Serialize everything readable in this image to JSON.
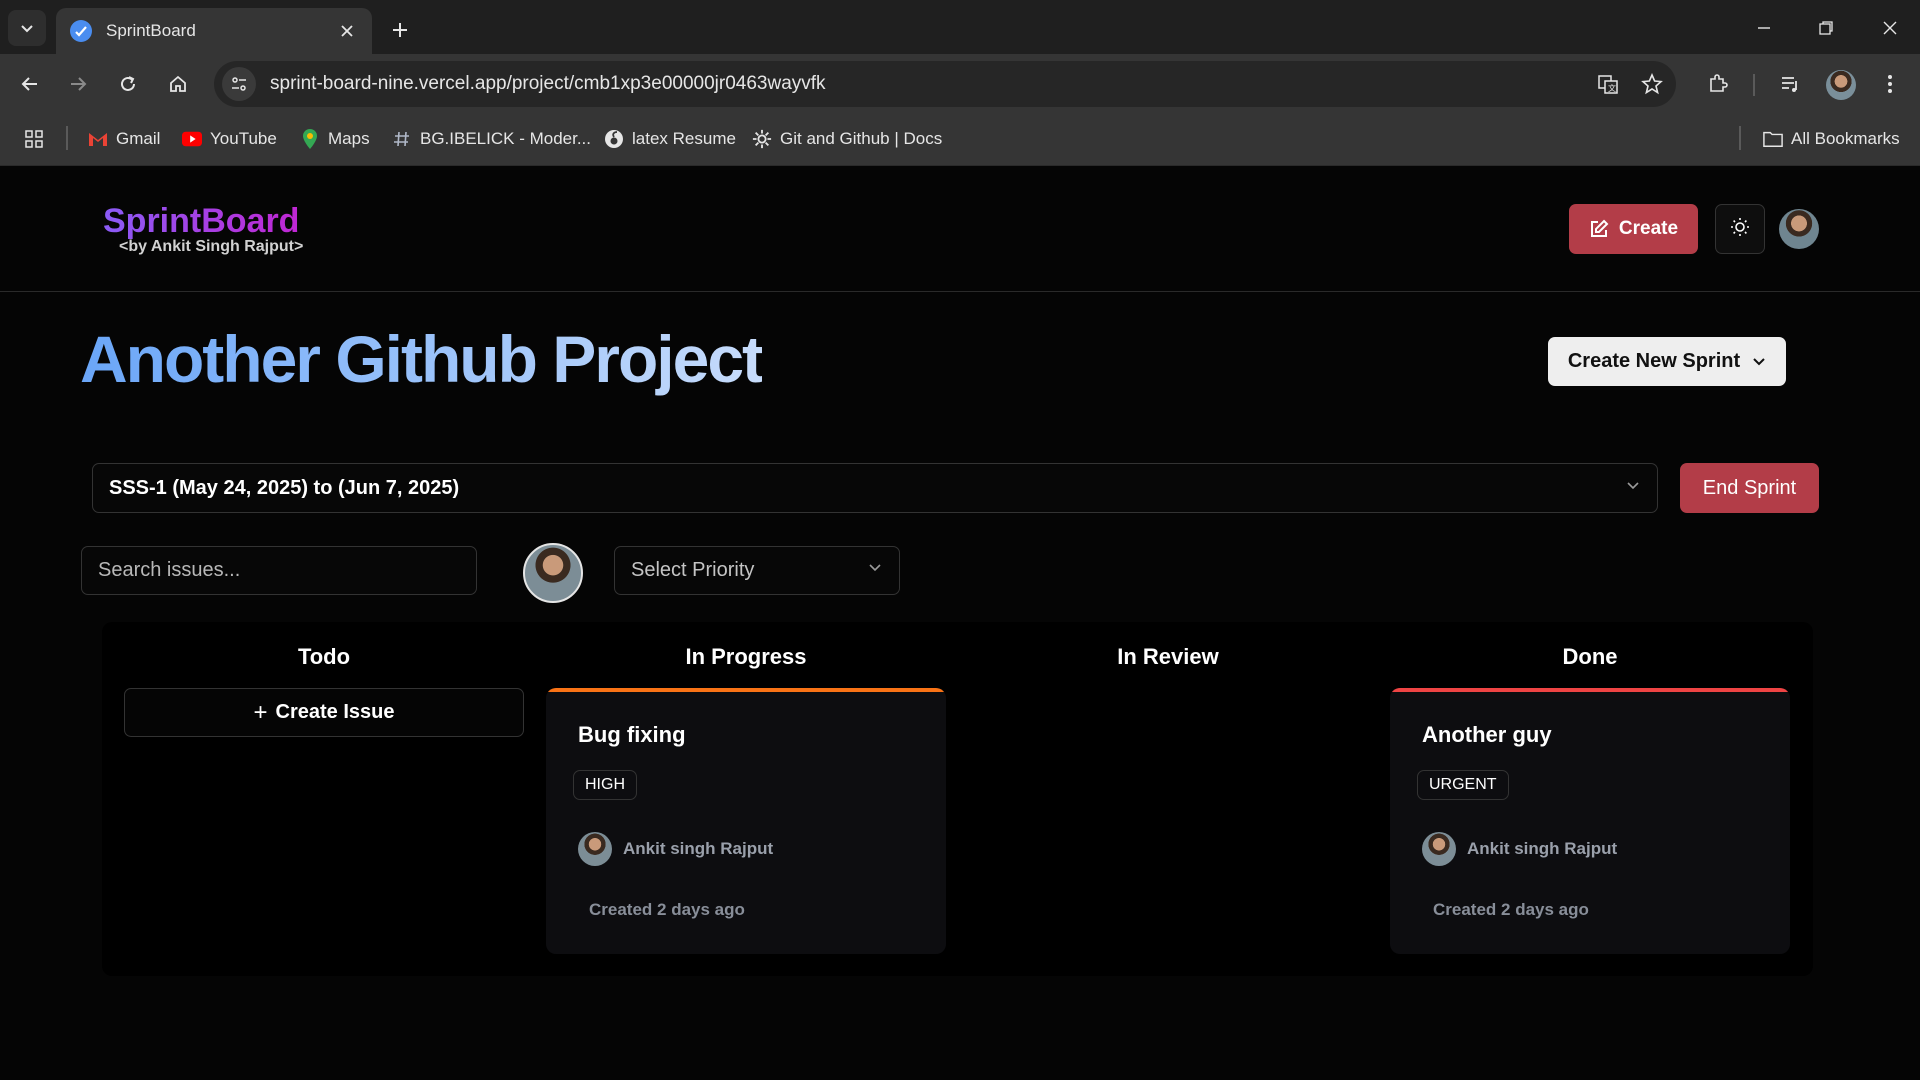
{
  "browser": {
    "tab_title": "SprintBoard",
    "url": "sprint-board-nine.vercel.app/project/cmb1xp3e00000jr0463wayvfk",
    "bookmarks": [
      {
        "label": "Gmail",
        "icon": "gmail-icon"
      },
      {
        "label": "YouTube",
        "icon": "youtube-icon"
      },
      {
        "label": "Maps",
        "icon": "maps-icon"
      },
      {
        "label": "BG.IBELICK - Moder...",
        "icon": "hash-icon"
      },
      {
        "label": "latex Resume",
        "icon": "overleaf-icon"
      },
      {
        "label": "Git and Github | Docs",
        "icon": "gear-icon"
      }
    ],
    "all_bookmarks": "All Bookmarks"
  },
  "header": {
    "logo": "SprintBoard",
    "logo_sub": "<by Ankit Singh Rajput>",
    "create_label": "Create"
  },
  "project": {
    "title": "Another Github Project",
    "create_sprint_label": "Create New Sprint"
  },
  "sprint": {
    "selected": "SSS-1 (May 24, 2025) to (Jun 7, 2025)",
    "end_label": "End Sprint"
  },
  "filters": {
    "search_placeholder": "Search issues...",
    "priority_placeholder": "Select Priority"
  },
  "board": {
    "columns": [
      {
        "title": "Todo"
      },
      {
        "title": "In Progress"
      },
      {
        "title": "In Review"
      },
      {
        "title": "Done"
      }
    ],
    "create_issue_label": "Create Issue",
    "cards": [
      {
        "title": "Bug fixing",
        "priority": "HIGH",
        "assignee": "Ankit singh Rajput",
        "created": "Created 2 days ago",
        "accent": "#f97316"
      },
      {
        "title": "Another guy",
        "priority": "URGENT",
        "assignee": "Ankit singh Rajput",
        "created": "Created 2 days ago",
        "accent": "#ef4444"
      }
    ]
  },
  "colors": {
    "accent_red": "#b33d48",
    "high_priority": "#f97316",
    "urgent_priority": "#ef4444"
  }
}
